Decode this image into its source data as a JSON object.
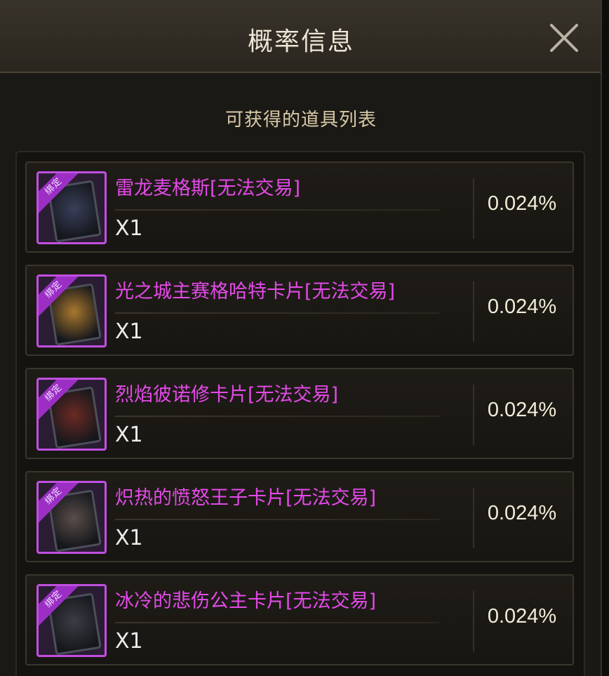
{
  "dialog": {
    "title": "概率信息",
    "subtitle": "可获得的道具列表"
  },
  "items": [
    {
      "name": "雷龙麦格斯[无法交易]",
      "qty": "X1",
      "probability": "0.024%",
      "badge": "绑定",
      "art_color": "#3a3f5a"
    },
    {
      "name": "光之城主赛格哈特卡片[无法交易]",
      "qty": "X1",
      "probability": "0.024%",
      "badge": "绑定",
      "art_color": "#a9782d"
    },
    {
      "name": "烈焰彼诺修卡片[无法交易]",
      "qty": "X1",
      "probability": "0.024%",
      "badge": "绑定",
      "art_color": "#6b2a24"
    },
    {
      "name": "炽热的愤怒王子卡片[无法交易]",
      "qty": "X1",
      "probability": "0.024%",
      "badge": "绑定",
      "art_color": "#5a4d49"
    },
    {
      "name": "冰冷的悲伤公主卡片[无法交易]",
      "qty": "X1",
      "probability": "0.024%",
      "badge": "绑定",
      "art_color": "#3b3d44"
    }
  ],
  "colors": {
    "item_name": "#e34ae8",
    "rarity_border": "#c14fe0",
    "title_text": "#ece6d6",
    "subtitle_text": "#d9cba8"
  },
  "icons": [
    "close-icon"
  ]
}
